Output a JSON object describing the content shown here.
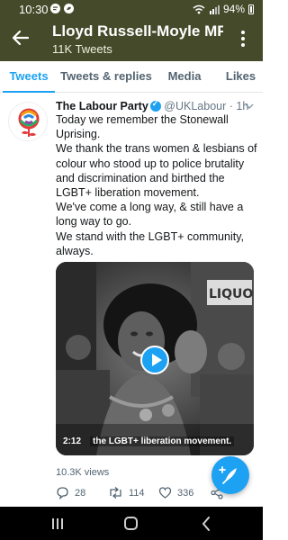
{
  "status_bar": {
    "time": "10:30",
    "battery": "94%",
    "icons": [
      "message-icon",
      "twitter-icon",
      "wifi-icon",
      "signal-icon",
      "battery-icon"
    ]
  },
  "header": {
    "title": "Lloyd Russell-Moyle MP...",
    "subtitle": "11K Tweets",
    "background_color": "#454b2a"
  },
  "tabs": [
    {
      "label": "Tweets",
      "active": true
    },
    {
      "label": "Tweets & replies",
      "active": false
    },
    {
      "label": "Media",
      "active": false
    },
    {
      "label": "Likes",
      "active": false
    }
  ],
  "tweet": {
    "author_name": "The Labour Party",
    "handle": "@UKLabour",
    "dot": "·",
    "age": "1h",
    "lines": [
      "Today we remember the Stonewall Uprising.",
      "We thank the trans women & lesbians of colour who stood up to police brutality and discrimination and birthed the LGBT+ liberation movement.",
      "We've come a long way, & still have a long way to go.",
      "We stand with the LGBT+ community, always."
    ],
    "video": {
      "duration": "2:12",
      "caption": "the LGBT+ liberation movement.",
      "sign_text": "LIQUORS"
    },
    "views": "10.3K views",
    "reply_count": "28",
    "retweet_count": "114",
    "like_count": "336"
  },
  "colors": {
    "accent": "#1da1f2",
    "text": "#14171a",
    "muted": "#657786"
  }
}
